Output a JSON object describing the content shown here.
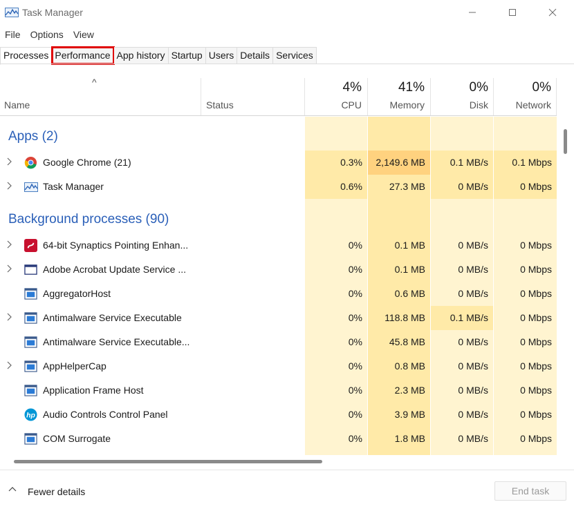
{
  "window": {
    "title": "Task Manager",
    "minimize": "—",
    "maximize": "☐",
    "close": "✕"
  },
  "menu": [
    "File",
    "Options",
    "View"
  ],
  "tabs": [
    "Processes",
    "Performance",
    "App history",
    "Startup",
    "Users",
    "Details",
    "Services"
  ],
  "active_tab": "Processes",
  "highlighted_tab": "Performance",
  "header": {
    "sort_arrow": "^",
    "name": "Name",
    "status": "Status",
    "cpu_pct": "4%",
    "cpu": "CPU",
    "memory_pct": "41%",
    "memory": "Memory",
    "disk_pct": "0%",
    "disk": "Disk",
    "network_pct": "0%",
    "network": "Network"
  },
  "groups": {
    "apps": "Apps (2)",
    "background": "Background processes (90)"
  },
  "apps": [
    {
      "name": "Google Chrome (21)",
      "icon": "chrome-icon",
      "expandable": true,
      "cpu": "0.3%",
      "memory": "2,149.6 MB",
      "disk": "0.1 MB/s",
      "network": "0.1 Mbps"
    },
    {
      "name": "Task Manager",
      "icon": "task-manager-icon",
      "expandable": true,
      "cpu": "0.6%",
      "memory": "27.3 MB",
      "disk": "0 MB/s",
      "network": "0 Mbps"
    }
  ],
  "background": [
    {
      "name": "64-bit Synaptics Pointing Enhan...",
      "icon": "synaptics-icon",
      "expandable": true,
      "cpu": "0%",
      "memory": "0.1 MB",
      "disk": "0 MB/s",
      "network": "0 Mbps"
    },
    {
      "name": "Adobe Acrobat Update Service ...",
      "icon": "window-icon",
      "expandable": true,
      "cpu": "0%",
      "memory": "0.1 MB",
      "disk": "0 MB/s",
      "network": "0 Mbps"
    },
    {
      "name": "AggregatorHost",
      "icon": "service-icon",
      "expandable": false,
      "cpu": "0%",
      "memory": "0.6 MB",
      "disk": "0 MB/s",
      "network": "0 Mbps"
    },
    {
      "name": "Antimalware Service Executable",
      "icon": "service-icon",
      "expandable": true,
      "cpu": "0%",
      "memory": "118.8 MB",
      "disk": "0.1 MB/s",
      "network": "0 Mbps"
    },
    {
      "name": "Antimalware Service Executable...",
      "icon": "service-icon",
      "expandable": false,
      "cpu": "0%",
      "memory": "45.8 MB",
      "disk": "0 MB/s",
      "network": "0 Mbps"
    },
    {
      "name": "AppHelperCap",
      "icon": "service-icon",
      "expandable": true,
      "cpu": "0%",
      "memory": "0.8 MB",
      "disk": "0 MB/s",
      "network": "0 Mbps"
    },
    {
      "name": "Application Frame Host",
      "icon": "service-icon",
      "expandable": false,
      "cpu": "0%",
      "memory": "2.3 MB",
      "disk": "0 MB/s",
      "network": "0 Mbps"
    },
    {
      "name": "Audio Controls Control Panel",
      "icon": "hp-icon",
      "expandable": false,
      "cpu": "0%",
      "memory": "3.9 MB",
      "disk": "0 MB/s",
      "network": "0 Mbps"
    },
    {
      "name": "COM Surrogate",
      "icon": "service-icon",
      "expandable": false,
      "cpu": "0%",
      "memory": "1.8 MB",
      "disk": "0 MB/s",
      "network": "0 Mbps"
    }
  ],
  "footer": {
    "fewer_details": "Fewer details",
    "end_task": "End task"
  },
  "colors": {
    "group_text": "#2a5fb8",
    "heat_light": "#fff4d0",
    "heat_mid": "#ffeaa8",
    "heat_strong": "#ffd27f",
    "highlight_outline": "#e00000"
  }
}
